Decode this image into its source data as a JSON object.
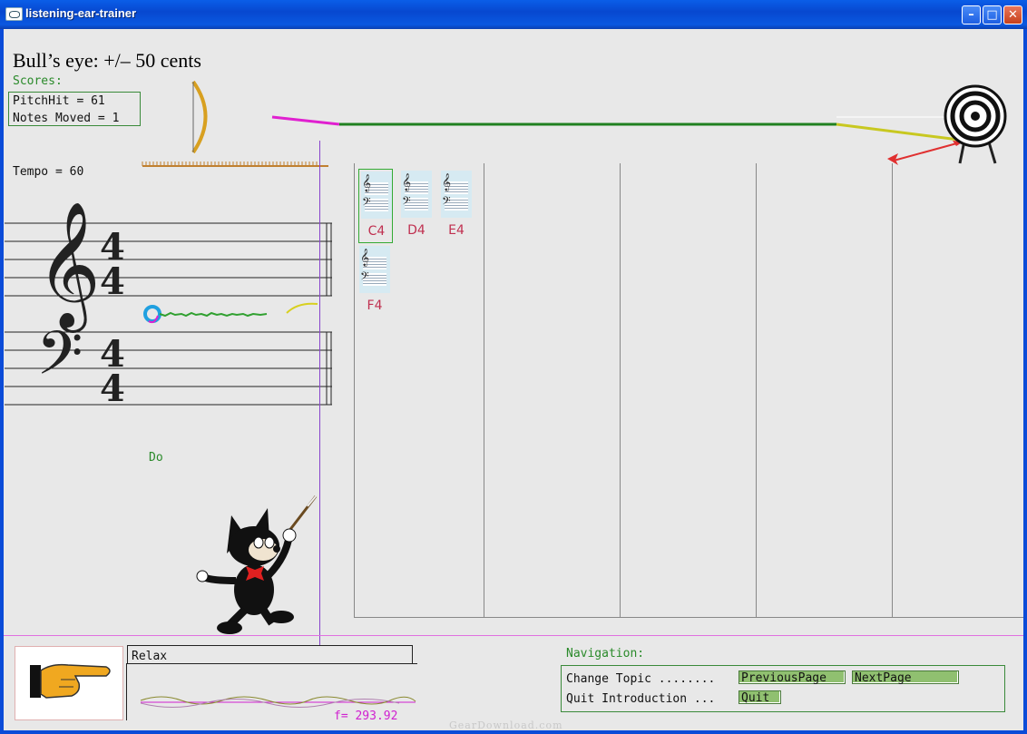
{
  "window": {
    "title": "listening-ear-trainer"
  },
  "header": {
    "bulls_eye": "Bull’s eye: +/– 50 cents",
    "scores_label": "Scores:",
    "pitch_hit": "PitchHit = 61",
    "notes_moved": "Notes Moved = 1",
    "tempo": "Tempo = 60"
  },
  "staff": {
    "time_signature_top": "4",
    "time_signature_bottom": "4",
    "syllable": "Do"
  },
  "notes": [
    {
      "label": "C4",
      "selected": true
    },
    {
      "label": "D4",
      "selected": false
    },
    {
      "label": "E4",
      "selected": false
    },
    {
      "label": "F4",
      "selected": false
    }
  ],
  "bottom": {
    "message": "Relax",
    "frequency": "f= 293.92"
  },
  "navigation": {
    "label": "Navigation:",
    "change_topic": "Change Topic ........",
    "quit_intro": "Quit Introduction ...",
    "previous": "PreviousPage",
    "next": "NextPage",
    "quit": "Quit"
  },
  "watermark": "GearDownload.com",
  "colors": {
    "accent_green": "#2a8a2a",
    "frequency_magenta": "#d020d0",
    "note_label": "#c03050",
    "nav_button": "#90c070"
  }
}
